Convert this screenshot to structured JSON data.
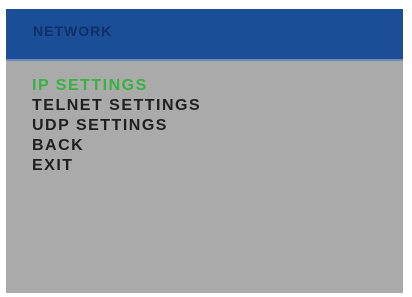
{
  "header": {
    "title": "NETWORK"
  },
  "menu": {
    "items": [
      {
        "label": "IP SETTINGS"
      },
      {
        "label": "TELNET SETTINGS"
      },
      {
        "label": "UDP SETTINGS"
      },
      {
        "label": "BACK"
      },
      {
        "label": "EXIT"
      }
    ],
    "selected_index": 0
  },
  "colors": {
    "title_bar_bg": "#1c4e98",
    "title_text": "#0f2f66",
    "panel_bg": "#a9aaa9",
    "menu_text": "#1f1f1f",
    "selected_text": "#37b33f"
  }
}
